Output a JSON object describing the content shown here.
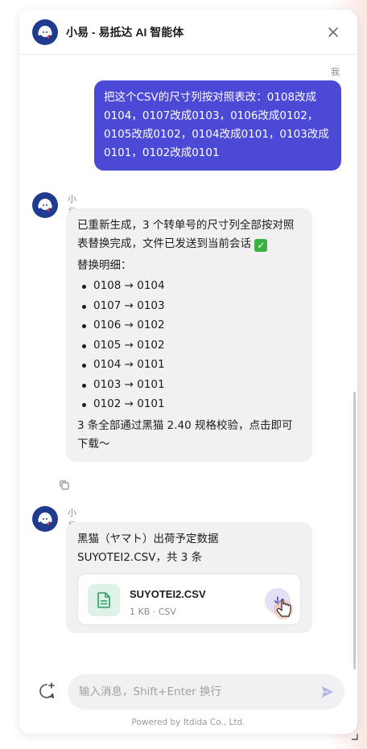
{
  "header": {
    "title": "小易 - 易抵达 AI 智能体",
    "avatar_icon": "bot-headset-icon",
    "close_icon": "close-icon"
  },
  "messages": {
    "user_label": "我",
    "user_text": "把这个CSV的尺寸列按对照表改：0108改成0104，0107改成0103，0106改成0102，0105改成0102，0104改成0101，0103改成0101，0102改成0101",
    "bot_name": "小易",
    "reply1": {
      "intro": "已重新生成，3 个转单号的尺寸列全部按对照表替换完成，文件已发送到当前会话",
      "details_heading": "替换明细：",
      "items": [
        "0108 → 0104",
        "0107 → 0103",
        "0106 → 0102",
        "0105 → 0102",
        "0104 → 0101",
        "0103 → 0101",
        "0102 → 0101"
      ],
      "conclusion": "3 条全部通过黑猫 2.40 规格校验，点击即可下载～"
    },
    "reply2": {
      "text": "黑猫（ヤマト）出荷予定数据 SUYOTEI2.CSV，共 3 条",
      "file_name": "SUYOTEI2.CSV",
      "file_meta": "1 KB · CSV"
    }
  },
  "input": {
    "placeholder": "输入消息，Shift+Enter 换行",
    "value": ""
  },
  "footer": {
    "powered_by": "Powered by Itdida Co., Ltd."
  },
  "colors": {
    "accent": "#4b49d6",
    "bot_bubble": "#f1f1f4",
    "file_icon_bg": "#dff2e8",
    "file_icon_fg": "#2e9a63"
  }
}
